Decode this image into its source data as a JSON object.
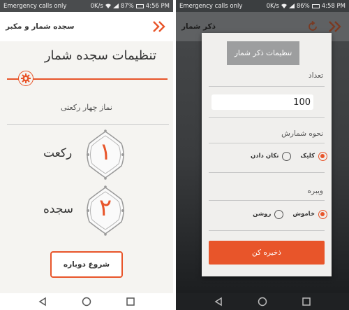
{
  "colors": {
    "accent": "#e8552a",
    "statusbar": "#4a4c4e",
    "dialog_title_bg": "#9d9e9f"
  },
  "status": {
    "carrier": "Emergency calls only",
    "data_speed": "0K/s",
    "left_battery": "87%",
    "left_time": "4:56 PM",
    "right_battery": "86%",
    "right_time": "4:58 PM"
  },
  "left": {
    "app_title": "سجده شمار و مکبر",
    "settings_title": "تنظیمات سجده شمار",
    "prayer_name": "نماز چهار رکعتی",
    "rakat_label": "رکعت",
    "rakat_value": "۱",
    "sajde_label": "سجده",
    "sajde_value": "۲",
    "restart_button": "شروع دوباره"
  },
  "right": {
    "app_title": "ذکر شمار",
    "dialog_title": "تنظیمات ذکر شمار",
    "count_label": "تعداد",
    "count_value": "100",
    "counting_method_label": "نحوه شمارش",
    "option_click": "کلیک",
    "option_shake": "تکان دادن",
    "vibrate_label": "ویبره",
    "option_off": "خاموش",
    "option_on": "روشن",
    "save_button": "ذخیره کن"
  },
  "icons": {
    "app_chevron": "double-chevron-right-icon",
    "gear": "gear-icon",
    "refresh": "refresh-icon",
    "nav": [
      "back-triangle-icon",
      "home-circle-icon",
      "recents-square-icon"
    ]
  },
  "selections": {
    "counting_method": "option_click",
    "vibrate": "option_off"
  }
}
